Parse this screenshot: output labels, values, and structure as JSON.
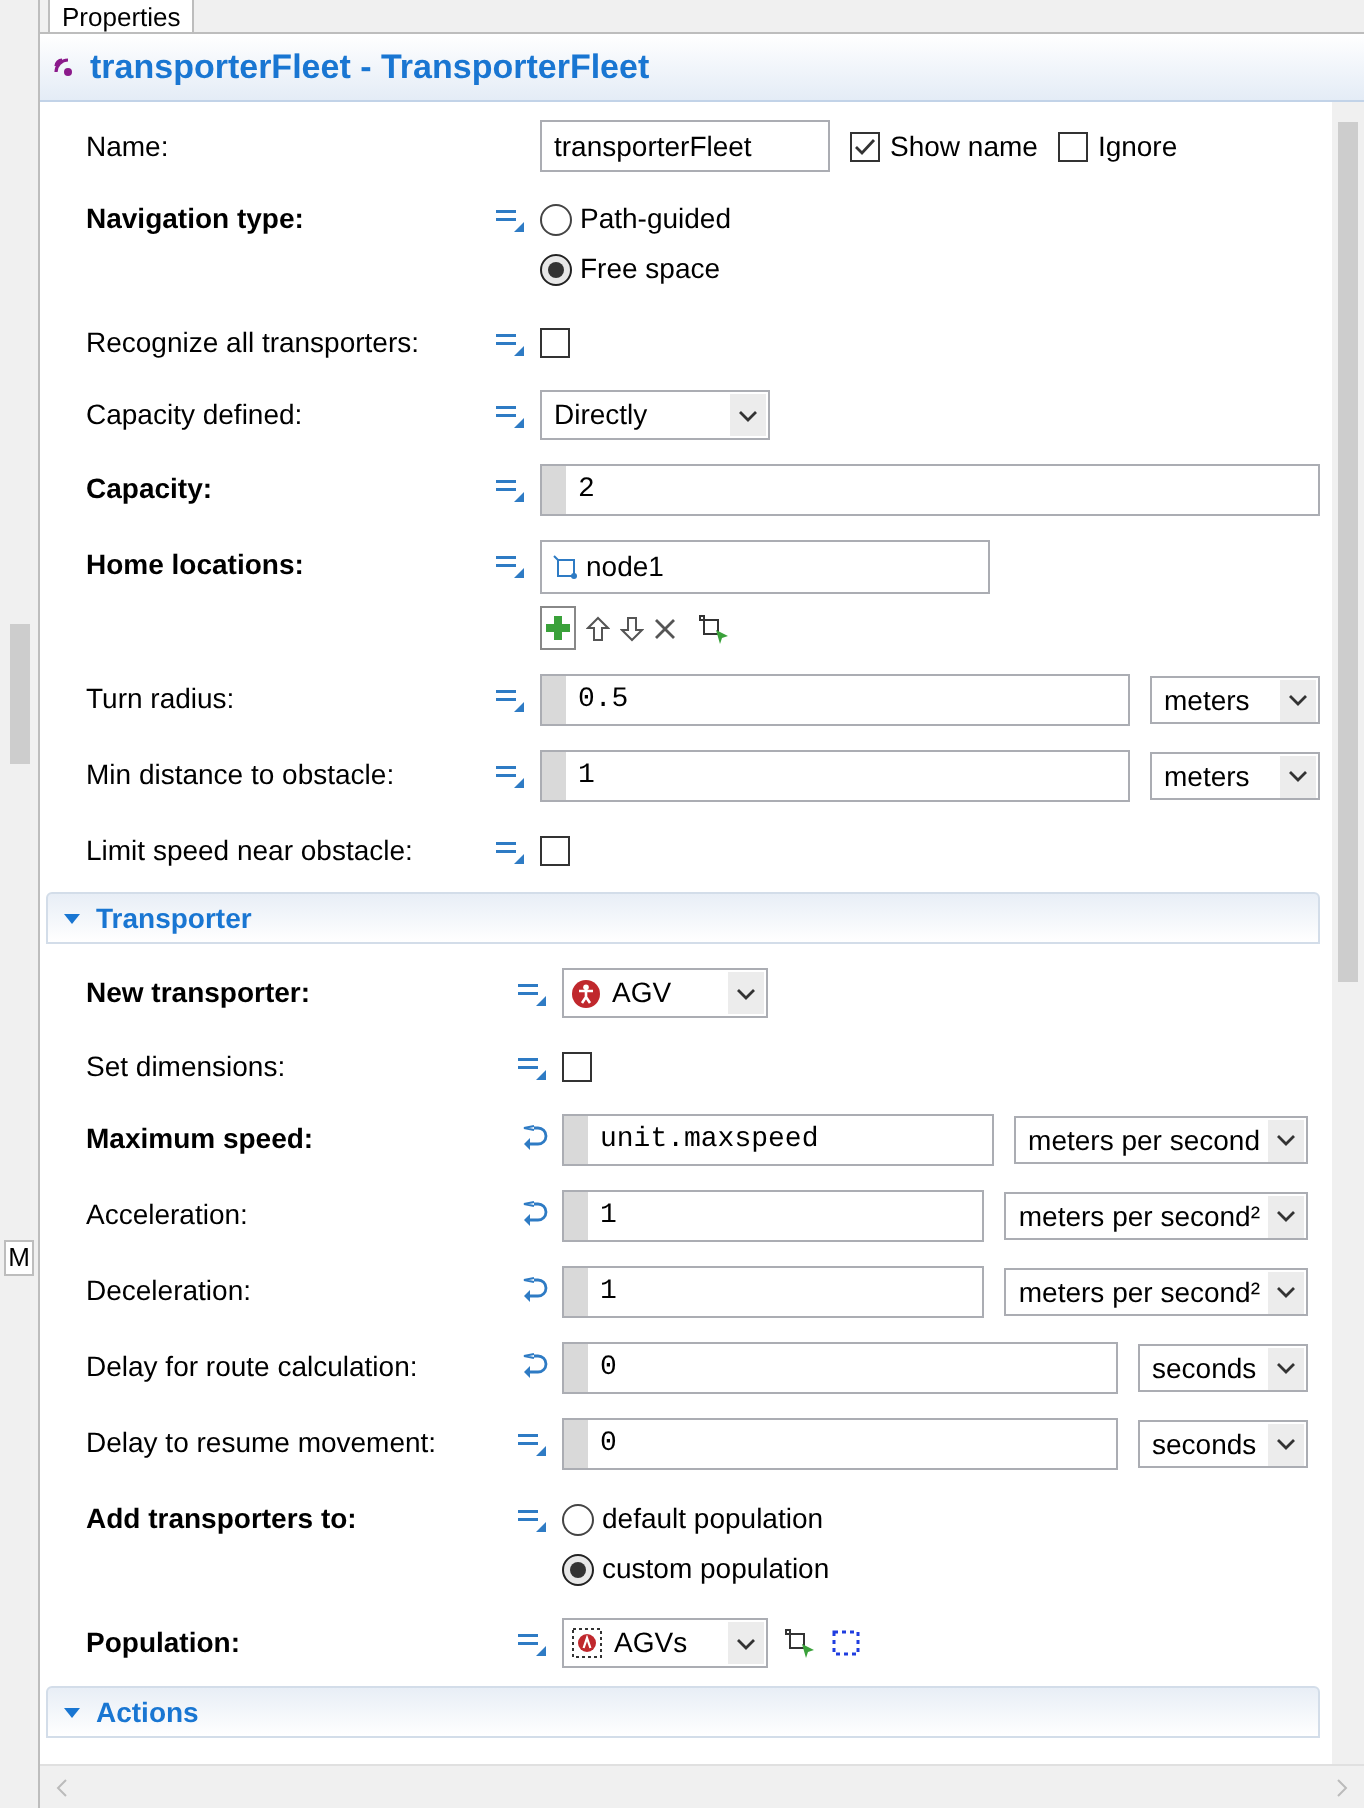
{
  "tab": {
    "label": "Properties"
  },
  "title": "transporterFleet - TransporterFleet",
  "left_fragment": "M",
  "sections": [
    {
      "fields": [
        {
          "kind": "name",
          "label": "Name:",
          "bold": false,
          "value": "transporterFleet",
          "options": [
            {
              "label": "Show name",
              "checked": true
            },
            {
              "label": "Ignore",
              "checked": false
            }
          ]
        },
        {
          "kind": "radio",
          "label": "Navigation type:",
          "bold": true,
          "dynamic": false,
          "options": [
            {
              "label": "Path-guided",
              "selected": false
            },
            {
              "label": "Free space",
              "selected": true
            }
          ]
        },
        {
          "kind": "checkbox",
          "label": "Recognize all transporters:",
          "bold": false,
          "dynamic": false,
          "checked": false
        },
        {
          "kind": "dropdown",
          "label": "Capacity defined:",
          "bold": false,
          "dynamic": false,
          "value": "Directly"
        },
        {
          "kind": "input",
          "label": "Capacity:",
          "bold": true,
          "dynamic": false,
          "value": "2"
        },
        {
          "kind": "list",
          "label": "Home locations:",
          "bold": true,
          "dynamic": false,
          "items": [
            "node1"
          ]
        },
        {
          "kind": "input",
          "label": "Turn radius:",
          "bold": false,
          "dynamic": false,
          "value": "0.5",
          "unit": "meters"
        },
        {
          "kind": "input",
          "label": "Min distance to obstacle:",
          "bold": false,
          "dynamic": false,
          "value": "1",
          "unit": "meters"
        },
        {
          "kind": "checkbox",
          "label": "Limit speed near obstacle:",
          "bold": false,
          "dynamic": false,
          "checked": false
        }
      ]
    },
    {
      "title": "Transporter",
      "expanded": true,
      "fields": [
        {
          "kind": "type_dropdown",
          "label": "New transporter:",
          "bold": true,
          "dynamic": false,
          "value": "AGV"
        },
        {
          "kind": "checkbox",
          "label": "Set dimensions:",
          "bold": false,
          "dynamic": false,
          "checked": false
        },
        {
          "kind": "input",
          "label": "Maximum speed:",
          "bold": true,
          "dynamic": true,
          "value": "unit.maxspeed",
          "unit": "meters per second"
        },
        {
          "kind": "input",
          "label": "Acceleration:",
          "bold": false,
          "dynamic": true,
          "value": "1",
          "unit": "meters per second²"
        },
        {
          "kind": "input",
          "label": "Deceleration:",
          "bold": false,
          "dynamic": true,
          "value": "1",
          "unit": "meters per second²"
        },
        {
          "kind": "input",
          "label": "Delay for route calculation:",
          "bold": false,
          "dynamic": true,
          "value": "0",
          "unit": "seconds"
        },
        {
          "kind": "input",
          "label": "Delay to resume movement:",
          "bold": false,
          "dynamic": false,
          "value": "0",
          "unit": "seconds"
        },
        {
          "kind": "radio",
          "label": "Add transporters to:",
          "bold": true,
          "dynamic": false,
          "options": [
            {
              "label": "default population",
              "selected": false
            },
            {
              "label": "custom population",
              "selected": true
            }
          ]
        },
        {
          "kind": "population_dropdown",
          "label": "Population:",
          "bold": true,
          "dynamic": false,
          "value": "AGVs"
        }
      ]
    },
    {
      "title": "Actions",
      "expanded": true
    }
  ]
}
